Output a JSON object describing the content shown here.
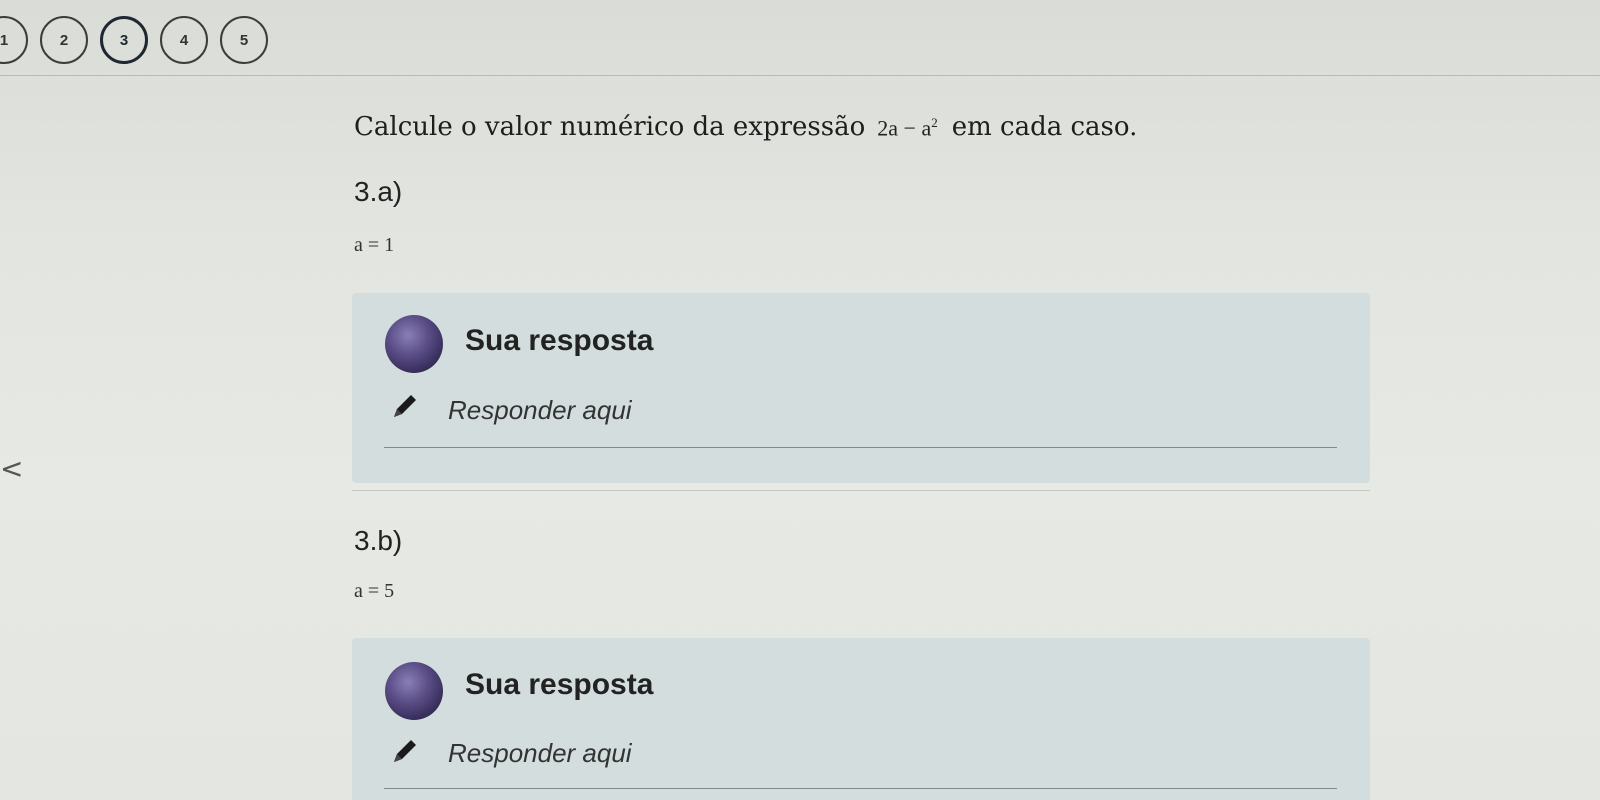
{
  "question_nav": {
    "items": [
      "1",
      "2",
      "3",
      "4",
      "5"
    ],
    "active": "3"
  },
  "prompt": {
    "text_before": "Calcule o valor numérico da expressão",
    "expression_base": "2a − a",
    "expression_exponent": "2",
    "text_after": "em cada caso."
  },
  "parts": [
    {
      "title": "3.a)",
      "equation": "a = 1",
      "answer_label": "Sua resposta",
      "answer_placeholder": "Responder aqui"
    },
    {
      "title": "3.b)",
      "equation": "a = 5",
      "answer_label": "Sua resposta",
      "answer_placeholder": "Responder aqui"
    }
  ],
  "nav": {
    "back_glyph": "<"
  },
  "colors": {
    "card_background": "#d3dddd",
    "active_border": "#1f2830"
  }
}
